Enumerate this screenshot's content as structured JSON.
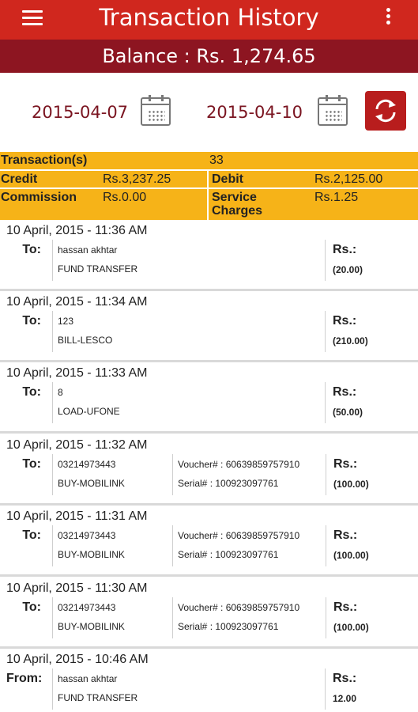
{
  "header": {
    "title": "Transaction History",
    "menu_icon": "hamburger-menu-icon",
    "overflow_icon": "overflow-menu-icon",
    "accent_color": "#d0271e"
  },
  "balance": {
    "text": "Balance : Rs. 1,274.65"
  },
  "dates": {
    "from": "2015-04-07",
    "to": "2015-04-10",
    "calendar_icon": "calendar-icon",
    "refresh_icon": "refresh-icon"
  },
  "summary": {
    "transactions_label": "Transaction(s)",
    "transactions_value": "33",
    "credit_label": "Credit",
    "credit_value": "Rs.3,237.25",
    "debit_label": "Debit",
    "debit_value": "Rs.2,125.00",
    "commission_label": "Commission",
    "commission_value": "Rs.0.00",
    "service_label_1": "Service",
    "service_label_2": "Charges",
    "service_value": "Rs.1.25"
  },
  "transactions": [
    {
      "datetime": "10 April, 2015 - 11:36 AM",
      "direction": "To:",
      "name": "hassan akhtar",
      "type": "FUND TRANSFER",
      "voucher": "",
      "serial": "",
      "rs_label": "Rs.:",
      "amount": "(20.00)"
    },
    {
      "datetime": "10 April, 2015 - 11:34 AM",
      "direction": "To:",
      "name": "123",
      "type": "BILL-LESCO",
      "voucher": "",
      "serial": "",
      "rs_label": "Rs.:",
      "amount": "(210.00)"
    },
    {
      "datetime": "10 April, 2015 - 11:33 AM",
      "direction": "To:",
      "name": "8",
      "type": "LOAD-UFONE",
      "voucher": "",
      "serial": "",
      "rs_label": "Rs.:",
      "amount": "(50.00)"
    },
    {
      "datetime": "10 April, 2015 - 11:32 AM",
      "direction": "To:",
      "name": "03214973443",
      "type": "BUY-MOBILINK",
      "voucher": "Voucher# : 60639859757910",
      "serial": "Serial# : 100923097761",
      "rs_label": "Rs.:",
      "amount": "(100.00)"
    },
    {
      "datetime": "10 April, 2015 - 11:31 AM",
      "direction": "To:",
      "name": "03214973443",
      "type": "BUY-MOBILINK",
      "voucher": "Voucher# : 60639859757910",
      "serial": "Serial# : 100923097761",
      "rs_label": "Rs.:",
      "amount": "(100.00)"
    },
    {
      "datetime": "10 April, 2015 - 11:30 AM",
      "direction": "To:",
      "name": "03214973443",
      "type": "BUY-MOBILINK",
      "voucher": "Voucher# : 60639859757910",
      "serial": "Serial# : 100923097761",
      "rs_label": "Rs.:",
      "amount": "(100.00)"
    },
    {
      "datetime": "10 April, 2015 - 10:46 AM",
      "direction": "From:",
      "name": "hassan akhtar",
      "type": "FUND TRANSFER",
      "voucher": "",
      "serial": "",
      "rs_label": "Rs.:",
      "amount": "12.00"
    }
  ]
}
